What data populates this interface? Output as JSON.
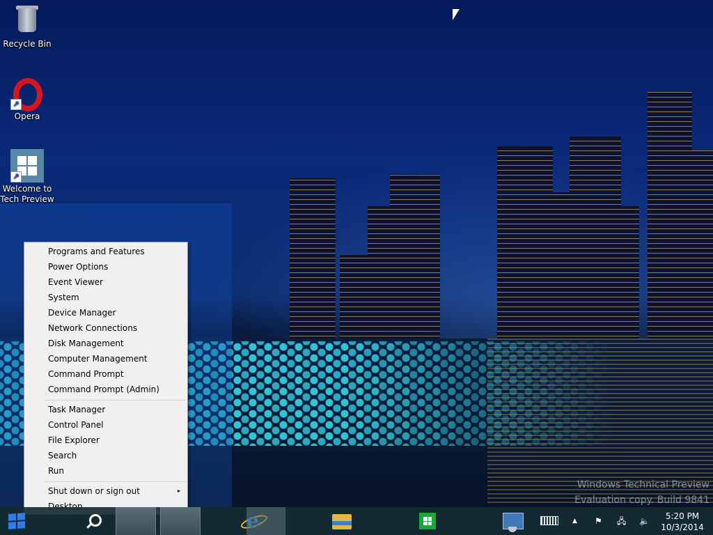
{
  "desktop": {
    "icons": [
      {
        "label": "Recycle Bin",
        "icon": "recycle-bin-icon"
      },
      {
        "label": "Opera",
        "icon": "opera-icon"
      },
      {
        "label": "Welcome to\nTech Preview",
        "line1": "Welcome to",
        "line2": "Tech Preview",
        "icon": "windows-tile-icon"
      }
    ],
    "watermark": {
      "line1": "Windows Technical Preview",
      "line2": "Evaluation copy. Build 9841"
    }
  },
  "context_menu": {
    "group1": [
      "Programs and Features",
      "Power Options",
      "Event Viewer",
      "System",
      "Device Manager",
      "Network Connections",
      "Disk Management",
      "Computer Management",
      "Command Prompt",
      "Command Prompt (Admin)"
    ],
    "group2": [
      "Task Manager",
      "Control Panel",
      "File Explorer",
      "Search",
      "Run"
    ],
    "group3": [
      "Shut down or sign out",
      "Desktop"
    ],
    "submenu_arrow": "▸"
  },
  "taskbar": {
    "buttons": [
      "start",
      "search",
      "task-view",
      "internet-explorer",
      "file-explorer",
      "store",
      "control-panel"
    ],
    "clock": {
      "time": "5:20 PM",
      "date": "10/3/2014"
    },
    "colors": {
      "accent": "#2f7cf0",
      "taskbar": "#162c34"
    }
  }
}
